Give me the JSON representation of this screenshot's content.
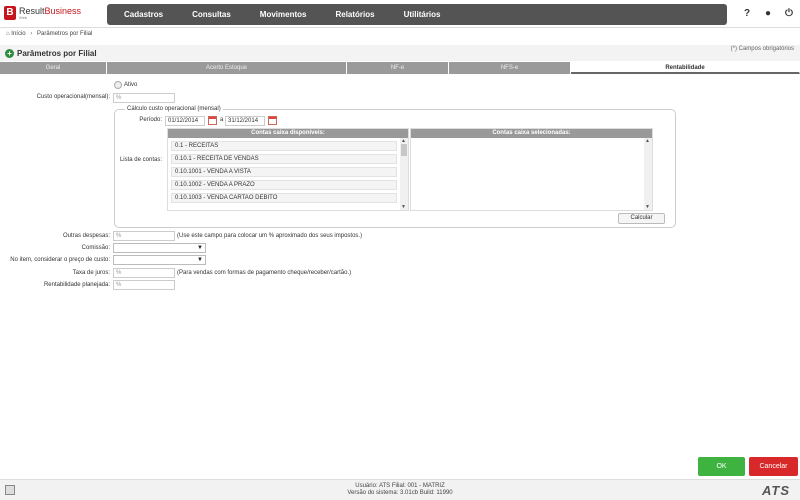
{
  "brand": {
    "name_prefix": "Result",
    "name_suffix": "Business",
    "sub": "Web",
    "mark": "B"
  },
  "menu": [
    "Cadastros",
    "Consultas",
    "Movimentos",
    "Relatórios",
    "Utilitários"
  ],
  "top_icons": {
    "help": "?",
    "user": "●",
    "power": "⏻"
  },
  "breadcrumb": {
    "home": "Início",
    "current": "Parâmetros por Filial"
  },
  "page": {
    "title": "Parâmetros por Filial",
    "required_note": "(*) Campos obrigatórios"
  },
  "tabs": [
    "Geral",
    "Acerto Estoque",
    "NF-e",
    "NFS-e",
    "Rentabilidade"
  ],
  "active_tab": "Rentabilidade",
  "form": {
    "ativo_label": "Ativo",
    "custo_label": "Custo operacional(mensal):",
    "custo_placeholder": "%",
    "fieldset_legend": "Cálculo custo operacional (mensal)",
    "periodo_label": "Período:",
    "periodo_from": "01/12/2014",
    "periodo_sep": "a",
    "periodo_to": "31/12/2014",
    "lista_label": "Lista de contas:",
    "available_header": "Contas caixa disponíveis:",
    "selected_header": "Contas caixa selecionadas:",
    "available_items": [
      "0.1 - RECEITAS",
      "0.10.1 - RECEITA DE VENDAS",
      "0.10.1001 - VENDA A VISTA",
      "0.10.1002 - VENDA A PRAZO",
      "0.10.1003 - VENDA CARTAO DEBITO"
    ],
    "calcular": "Calcular",
    "outras_label": "Outras despesas:",
    "outras_placeholder": "%",
    "outras_hint": "(Use este campo para colocar um % aproximado dos seus impostos.)",
    "comissao_label": "Comissão:",
    "preco_label": "No item, considerar o preço de custo:",
    "juros_label": "Taxa de juros:",
    "juros_placeholder": "%",
    "juros_hint": "(Para vendas com formas de pagamento cheque/receber/cartão.)",
    "rentab_label": "Rentabilidade planejada:",
    "rentab_placeholder": "%"
  },
  "buttons": {
    "ok": "OK",
    "cancel": "Cancelar"
  },
  "footer": {
    "line1": "Usuário: ATS   Filial: 001 - MATRIZ",
    "line2": "Versão do sistema: 3.01cb   Build: 11990",
    "logo": "ATS"
  },
  "colors": {
    "brand": "#c4161c",
    "menu_bg": "#545454",
    "ok": "#3fb33f",
    "cancel": "#d8282a"
  }
}
